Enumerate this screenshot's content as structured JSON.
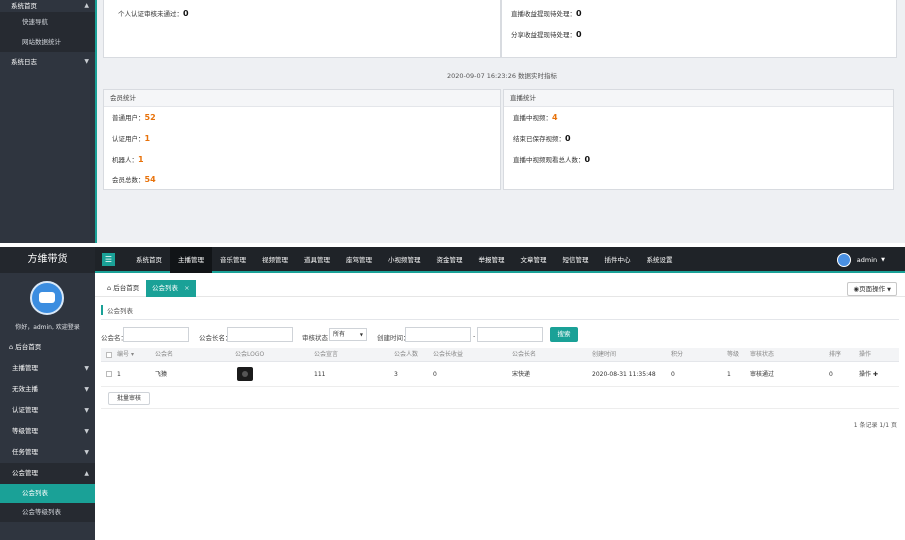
{
  "upper": {
    "sidebar": {
      "top_item": "系统首页",
      "subitems": [
        "快速导航",
        "网站数据统计"
      ],
      "log_item": "系统日志"
    },
    "top_left": {
      "label": "个人认证审核未通过：",
      "value": "0"
    },
    "top_right": [
      {
        "label": "直播收益提现待处理：",
        "value": "0"
      },
      {
        "label": "分享收益提现待处理：",
        "value": "0"
      }
    ],
    "timestamp": "2020-09-07 16:23:26 数据实时指标",
    "member_stats": {
      "title": "会员统计",
      "rows": [
        {
          "label": "普通用户：",
          "value": "52",
          "highlight": true
        },
        {
          "label": "认证用户：",
          "value": "1",
          "highlight": true
        },
        {
          "label": "机器人：",
          "value": "1",
          "highlight": true
        },
        {
          "label": "会员总数：",
          "value": "54",
          "highlight": true
        }
      ]
    },
    "live_stats": {
      "title": "直播统计",
      "rows": [
        {
          "label": "直播中视频：",
          "value": "4",
          "highlight": true
        },
        {
          "label": "结束已保存视频：",
          "value": "0",
          "highlight": false
        },
        {
          "label": "直播中视频观看总人数：",
          "value": "0",
          "highlight": false
        }
      ]
    }
  },
  "topbar": {
    "brand": "方维带货",
    "menu_icon": "hamburger-icon",
    "nav": [
      "系统首页",
      "主播管理",
      "音乐管理",
      "视频管理",
      "道具管理",
      "座驾管理",
      "小视频管理",
      "资金管理",
      "举报管理",
      "文章管理",
      "短信管理",
      "插件中心",
      "系统设置"
    ],
    "active_nav": 1,
    "user": "admin"
  },
  "sidebar": {
    "welcome": "你好，admin, 欢迎登录",
    "home": "后台首页",
    "menus": [
      "主播管理",
      "无效主播",
      "认证管理",
      "等级管理",
      "任务管理"
    ],
    "open_menu": "公会管理",
    "submenu": [
      "公会列表",
      "公会等级列表"
    ]
  },
  "tabs": {
    "home": "后台首页",
    "current": "公会列表",
    "close": "×",
    "page_ops": "页面操作"
  },
  "breadcrumb": "公会列表",
  "filters": {
    "guild_name": "公会名：",
    "guild_leader": "公会长名：",
    "review_status": "审核状态：",
    "review_value": "所有",
    "created": "创建时间：",
    "dash": "-",
    "search": "搜索"
  },
  "table": {
    "headers": [
      "编号",
      "公会名",
      "公会LOGO",
      "公会宣言",
      "公会人数",
      "公会长收益",
      "公会长名",
      "创建时间",
      "积分",
      "等级",
      "审核状态",
      "排序",
      "操作"
    ],
    "rows": [
      [
        "1",
        "飞猿",
        "",
        "111",
        "3",
        "0",
        "宋快递",
        "2020-08-31 11:35:48",
        "0",
        "1",
        "审核通过",
        "0",
        "操作 ✚"
      ]
    ],
    "batch": "批量审核",
    "pager": "1 条记录 1/1 页"
  },
  "colors": {
    "accent": "#1aa197",
    "sidebar": "#2f353f",
    "topbar": "#1f2328",
    "highlight": "#e8720a"
  }
}
